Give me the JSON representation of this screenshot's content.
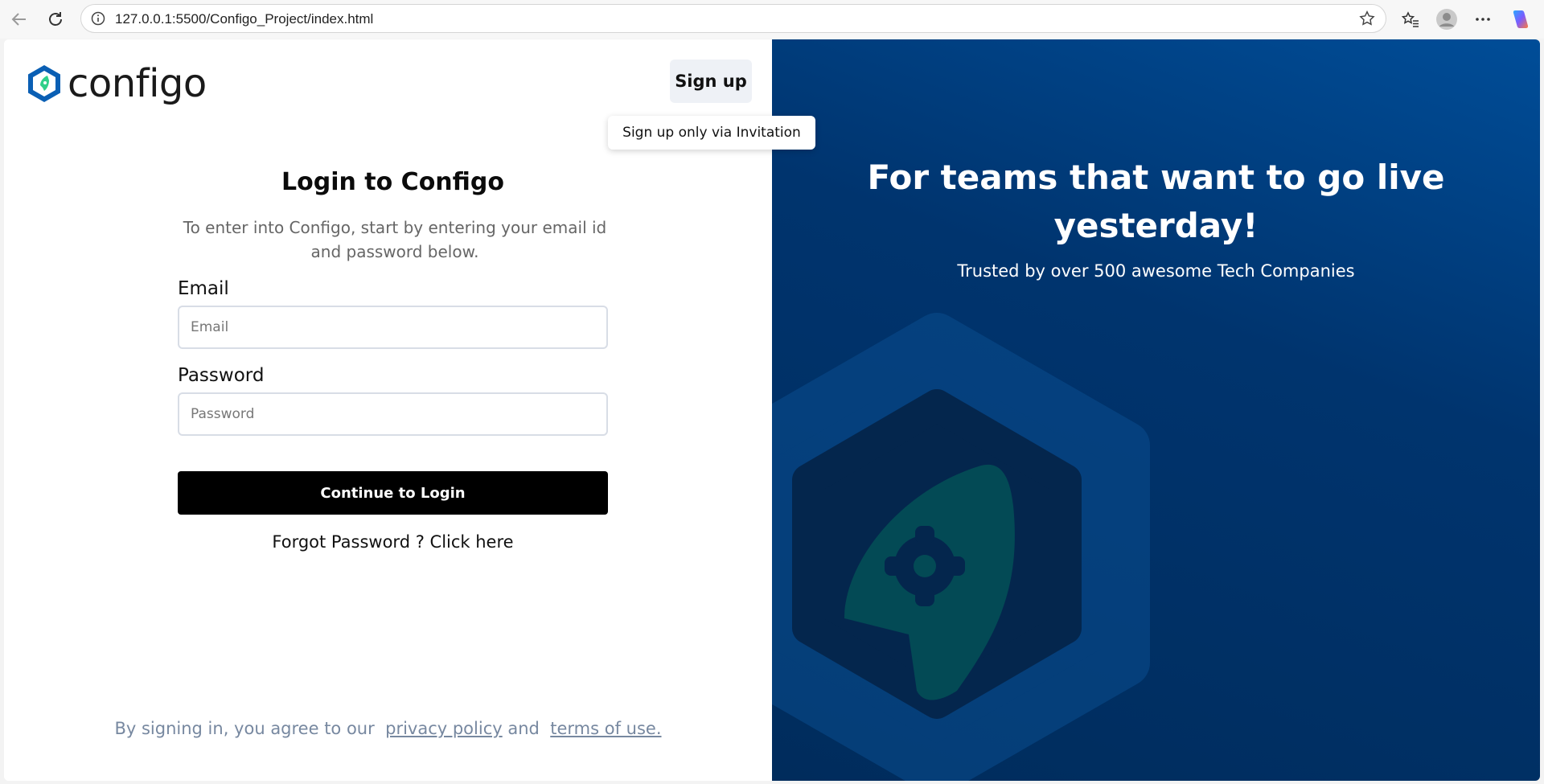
{
  "browser": {
    "url": "127.0.0.1:5500/Configo_Project/index.html",
    "icons": [
      "back-icon",
      "refresh-icon",
      "info-icon",
      "star-icon",
      "favorites-icon",
      "profile-icon",
      "more-icon",
      "copilot-icon"
    ]
  },
  "header": {
    "brand": "configo",
    "signup_label": "Sign up",
    "signup_tooltip": "Sign up only via Invitation"
  },
  "login": {
    "title": "Login to Configo",
    "subtitle": "To enter into Configo, start by entering your email id and password below.",
    "email_label": "Email",
    "email_placeholder": "Email",
    "password_label": "Password",
    "password_placeholder": "Password",
    "submit_label": "Continue to Login",
    "forgot_prefix": "Forgot Password ? ",
    "forgot_link": "Click here"
  },
  "legal": {
    "prefix": "By signing in, you agree to our",
    "privacy": "privacy policy",
    "and": "and",
    "terms": "terms of use."
  },
  "hero": {
    "title": "For teams that want to go live yesterday!",
    "subtitle": "Trusted by over 500 awesome Tech Companies"
  },
  "colors": {
    "accent": "#000000",
    "hero_bg": "#00346e",
    "brand_blue": "#0a5fb4",
    "brand_green": "#2fd08a"
  }
}
